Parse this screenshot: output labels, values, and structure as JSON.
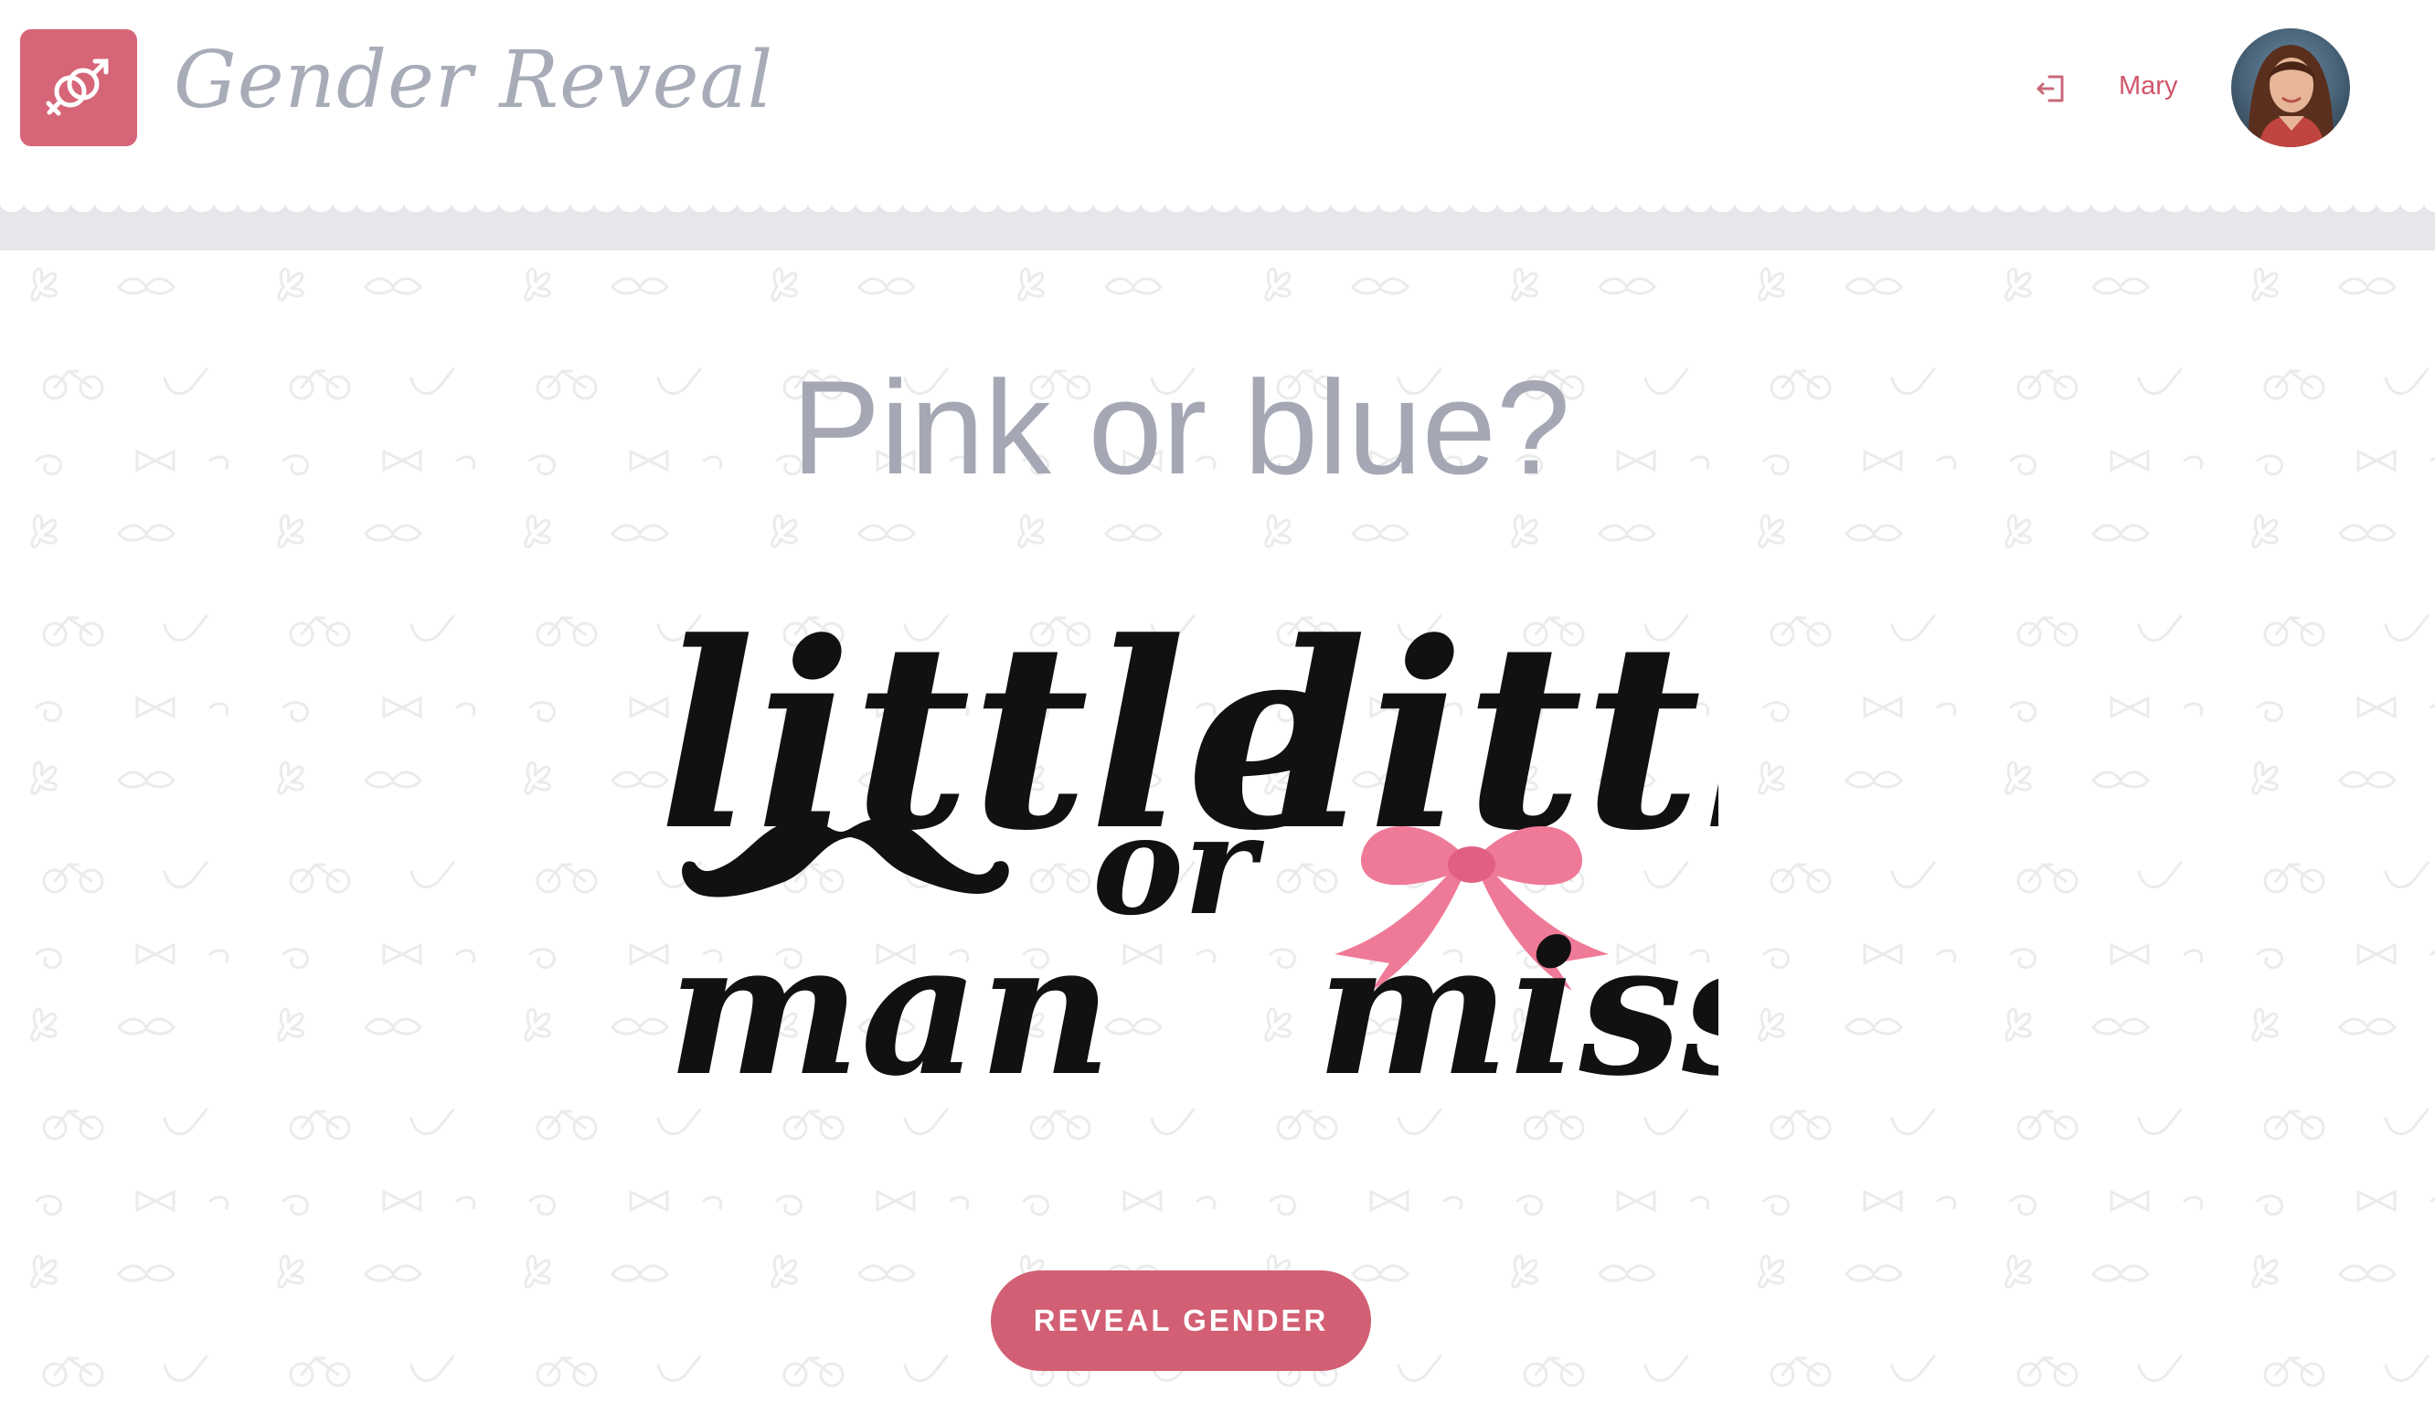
{
  "header": {
    "app_title": "Gender Reveal",
    "logo_icon": "gender-symbols-icon",
    "logout_icon": "logout-icon",
    "user_name": "Mary",
    "avatar": "user-avatar"
  },
  "main": {
    "headline": "Pink or blue?",
    "hero_art": {
      "left_top": "little",
      "left_bottom": "man",
      "middle": "or",
      "right_top": "little",
      "right_bottom": "miss",
      "left_ornament": "mustache-icon",
      "right_ornament": "bow-icon"
    },
    "reveal_button": "REVEAL GENDER"
  },
  "colors": {
    "accent": "#d25f73",
    "title_gray": "#a8acb8",
    "bow_pink": "#ef7a98",
    "band_gray": "#e6e7ea"
  }
}
